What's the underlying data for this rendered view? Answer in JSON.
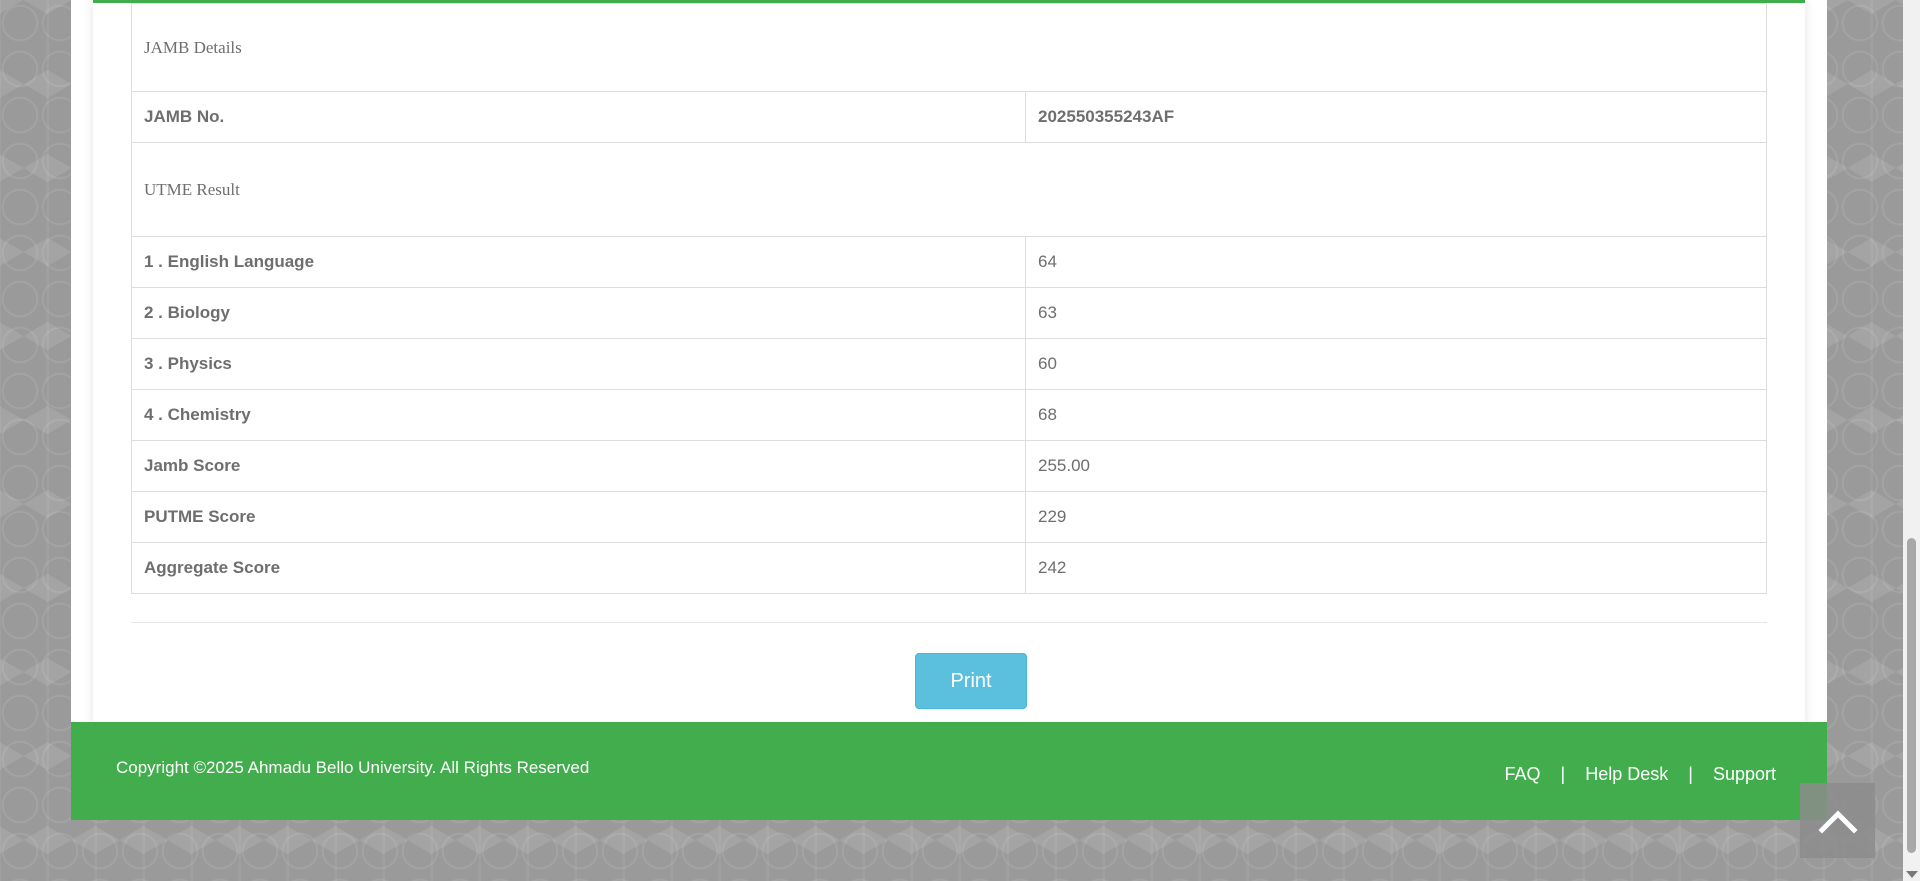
{
  "jamb_section": {
    "title": "JAMB Details",
    "jamb_no_label": "JAMB No.",
    "jamb_no_value": "202550355243AF"
  },
  "utme_section": {
    "title": "UTME Result",
    "rows": [
      {
        "label": "1 . English Language",
        "value": "64"
      },
      {
        "label": "2 . Biology",
        "value": "63"
      },
      {
        "label": "3 . Physics",
        "value": "60"
      },
      {
        "label": "4 . Chemistry",
        "value": "68"
      },
      {
        "label": "Jamb Score",
        "value": "255.00"
      },
      {
        "label": "PUTME Score",
        "value": "229"
      },
      {
        "label": "Aggregate Score",
        "value": "242"
      }
    ]
  },
  "actions": {
    "print_label": "Print"
  },
  "footer": {
    "copyright": "Copyright ©2025 Ahmadu Bello University. All Rights Reserved",
    "links": [
      "FAQ",
      "Help Desk",
      "Support"
    ],
    "separator": "|"
  },
  "icons": {
    "scroll_top": "chevron-up-icon"
  },
  "colors": {
    "accent_green": "#41ad4c",
    "print_button": "#5bc0de"
  }
}
